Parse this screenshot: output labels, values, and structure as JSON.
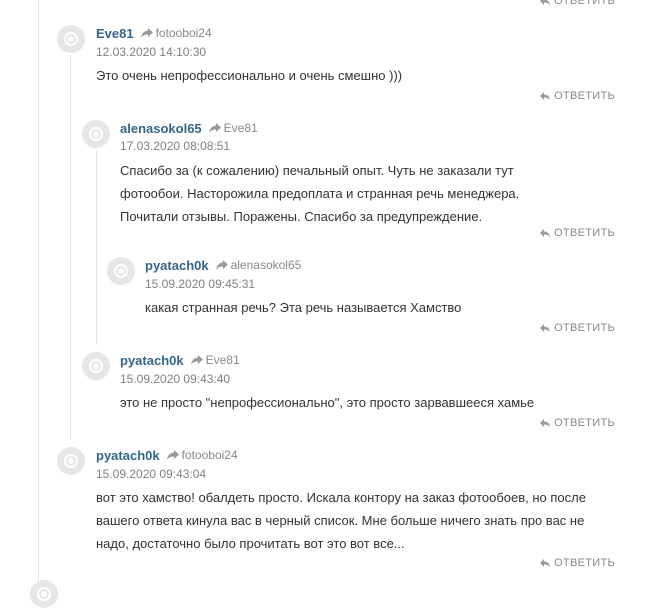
{
  "reply_label": "ОТВЕТИТЬ",
  "comments": [
    {
      "author": "Eve81",
      "reply_to": "fotooboi24",
      "date": "12.03.2020 14:10:30",
      "text": "Это очень непрофессионально и очень смешно )))"
    },
    {
      "author": "alenasokol65",
      "reply_to": "Eve81",
      "date": "17.03.2020 08:08:51",
      "text": "Спасибо за (к сожалению) печальный опыт. Чуть не заказали тут фотообои. Насторожила предоплата и странная речь менеджера. Почитали отзывы. Поражены. Спасибо за предупреждение."
    },
    {
      "author": "pyatach0k",
      "reply_to": "alenasokol65",
      "date": "15.09.2020 09:45:31",
      "text": "какая странная речь? Эта речь называется Хамство"
    },
    {
      "author": "pyatach0k",
      "reply_to": "Eve81",
      "date": "15.09.2020 09:43:40",
      "text": "это не просто \"непрофессионально\", это просто зарвавшееся хамье"
    },
    {
      "author": "pyatach0k",
      "reply_to": "fotooboi24",
      "date": "15.09.2020 09:43:04",
      "text": "вот это хамство! обалдеть просто. Искала контору на заказ фотообоев, но после вашего ответа кинула вас в черный список. Мне больше ничего знать про вас не надо, достаточно было прочитать вот это вот все..."
    }
  ]
}
